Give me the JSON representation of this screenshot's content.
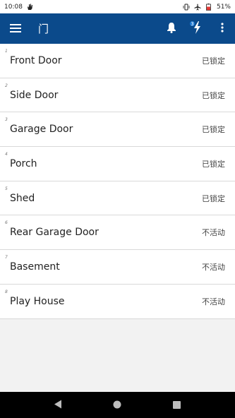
{
  "status_bar": {
    "time": "10:08",
    "battery": "51%"
  },
  "app_bar": {
    "title": "门",
    "notification_badge": "3"
  },
  "doors": [
    {
      "index": "1",
      "name": "Front Door",
      "status": "已锁定"
    },
    {
      "index": "2",
      "name": "Side Door",
      "status": "已锁定"
    },
    {
      "index": "3",
      "name": "Garage Door",
      "status": "已锁定"
    },
    {
      "index": "4",
      "name": "Porch",
      "status": "已锁定"
    },
    {
      "index": "5",
      "name": "Shed",
      "status": "已锁定"
    },
    {
      "index": "6",
      "name": "Rear Garage Door",
      "status": "不活动"
    },
    {
      "index": "7",
      "name": "Basement",
      "status": "不活动"
    },
    {
      "index": "8",
      "name": "Play House",
      "status": "不活动"
    }
  ],
  "colors": {
    "app_bar": "#0b4a8b",
    "badge": "#1976d2",
    "battery_low": "#e53935"
  },
  "icons": [
    "hand-icon",
    "vibrate-icon",
    "airplane-icon",
    "battery-icon",
    "menu-icon",
    "bell-icon",
    "bolt-icon",
    "more-vert-icon",
    "back-icon",
    "home-icon",
    "recents-icon"
  ]
}
